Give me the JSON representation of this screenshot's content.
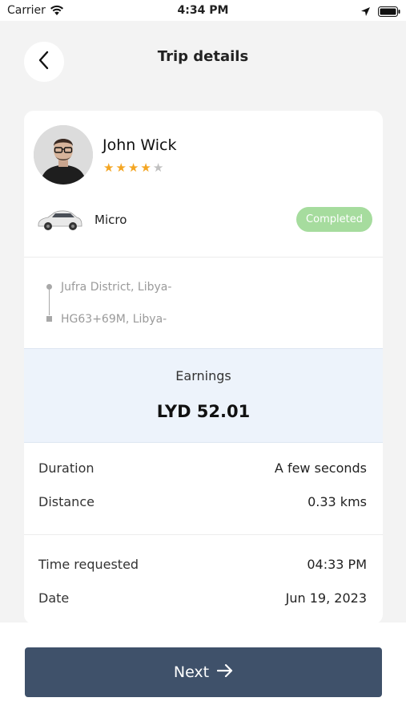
{
  "status_bar": {
    "carrier": "Carrier",
    "time": "4:34 PM",
    "icons": [
      "wifi-icon",
      "location-arrow-icon",
      "battery-icon"
    ]
  },
  "header": {
    "title": "Trip details",
    "back_icon": "chevron-left-icon"
  },
  "driver": {
    "name": "John Wick",
    "rating": 4.5,
    "max_rating": 5,
    "avatar_icon": "avatar"
  },
  "vehicle": {
    "type": "Micro",
    "icon": "car-icon"
  },
  "trip_status": {
    "label": "Completed",
    "color": "#a6dc9e"
  },
  "route": {
    "pickup": "Jufra District, Libya-",
    "dropoff": "HG63+69M, Libya-"
  },
  "earnings": {
    "label": "Earnings",
    "amount": "LYD 52.01"
  },
  "details": [
    {
      "label": "Duration",
      "value": "A few seconds"
    },
    {
      "label": "Distance",
      "value": "0.33 kms"
    },
    {
      "label": "Time requested",
      "value": "04:33 PM"
    },
    {
      "label": "Date",
      "value": "Jun 19, 2023"
    }
  ],
  "footer": {
    "next_label": "Next",
    "next_icon": "arrow-right-icon",
    "button_color": "#3f516a"
  }
}
